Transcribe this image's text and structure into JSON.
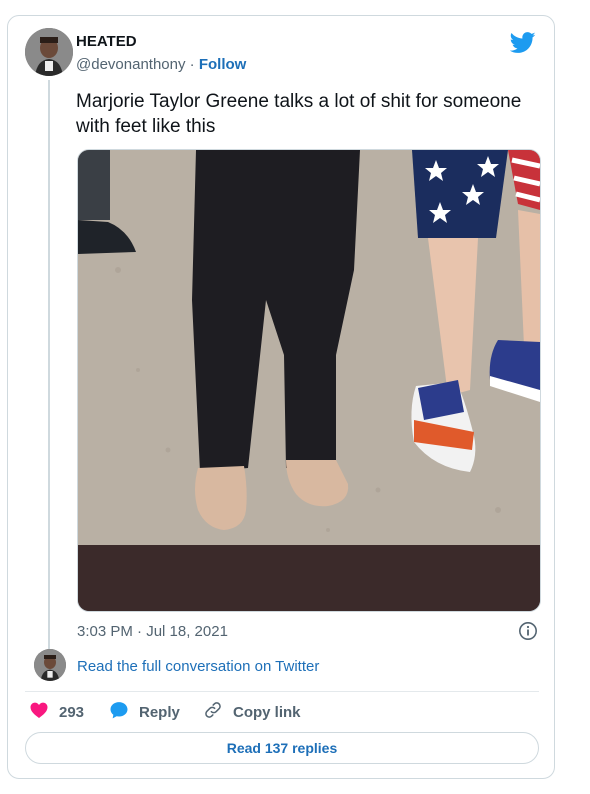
{
  "author": {
    "name": "HEATED",
    "handle": "@devonanthony",
    "separator": "·",
    "follow_label": "Follow"
  },
  "tweet": {
    "text": "Marjorie Taylor Greene talks a lot of shit for someone with feet like this",
    "timestamp": "3:03 PM · Jul 18, 2021"
  },
  "conversation": {
    "read_full_label": "Read the full conversation on Twitter"
  },
  "actions": {
    "like_count": "293",
    "reply_label": "Reply",
    "copy_link_label": "Copy link"
  },
  "footer": {
    "read_replies_label": "Read 137 replies"
  },
  "colors": {
    "link": "#1d6fb8",
    "like": "#f91880",
    "twitter_blue": "#1d9bf0",
    "muted": "#536471",
    "border": "#cfd9de"
  },
  "icons": {
    "brand": "twitter-bird-icon",
    "info": "info-icon",
    "like": "heart-icon",
    "reply": "speech-bubble-icon",
    "copy": "link-icon"
  }
}
